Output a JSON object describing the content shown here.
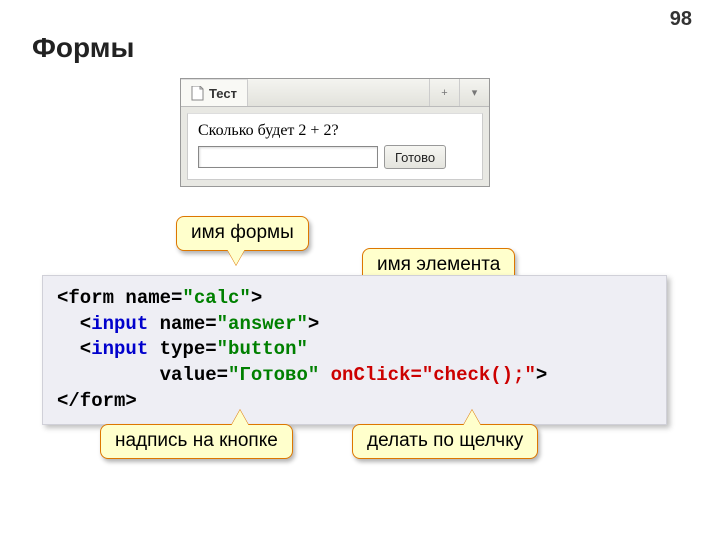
{
  "page_number": "98",
  "title": "Формы",
  "browser": {
    "tab_label": "Тест",
    "question": "Сколько будет 2 + 2?",
    "button_label": "Готово",
    "titlebar_plus": "+",
    "titlebar_down": "▾"
  },
  "callouts": {
    "form_name": "имя формы",
    "element_name": "имя элемента",
    "button_caption": "надпись на кнопке",
    "onclick_action": "делать по щелчку"
  },
  "code": {
    "l1_a": "<form name=",
    "l1_b": "\"calc\"",
    "l1_c": ">",
    "l2_a": "  <",
    "l2_b": "input",
    "l2_c": " name=",
    "l2_d": "\"answer\"",
    "l2_e": ">",
    "l3_a": "  <",
    "l3_b": "input",
    "l3_c": " type=",
    "l3_d": "\"button\"",
    "l4_a": "         value=",
    "l4_b": "\"Готово\"",
    "l4_c": " ",
    "l4_d": "onClick=\"check();\"",
    "l4_e": ">",
    "l5": "</form>"
  }
}
